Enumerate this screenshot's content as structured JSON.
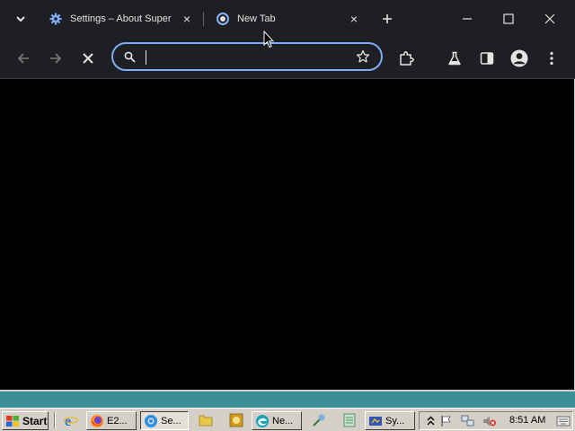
{
  "browser": {
    "tabs": [
      {
        "title": "Settings – About Super",
        "favicon": "gear-icon",
        "active": false
      },
      {
        "title": "New Tab",
        "favicon": "loading-spinner-icon",
        "active": true
      }
    ],
    "omnibox": {
      "value": "",
      "placeholder": ""
    },
    "colors": {
      "frame": "#1e1f22",
      "accent": "#7cacf8",
      "content": "#000000",
      "icon": "#e3e3e3"
    }
  },
  "taskbar": {
    "start_label": "Start",
    "tasks": [
      {
        "label": "E2...",
        "icon": "firefox-icon"
      },
      {
        "label": "Se...",
        "icon": "chrome-icon"
      },
      {
        "label": "Ne...",
        "icon": "edge-icon"
      },
      {
        "label": "Sy...",
        "icon": "system-icon"
      }
    ],
    "clock": "8:51 AM"
  }
}
